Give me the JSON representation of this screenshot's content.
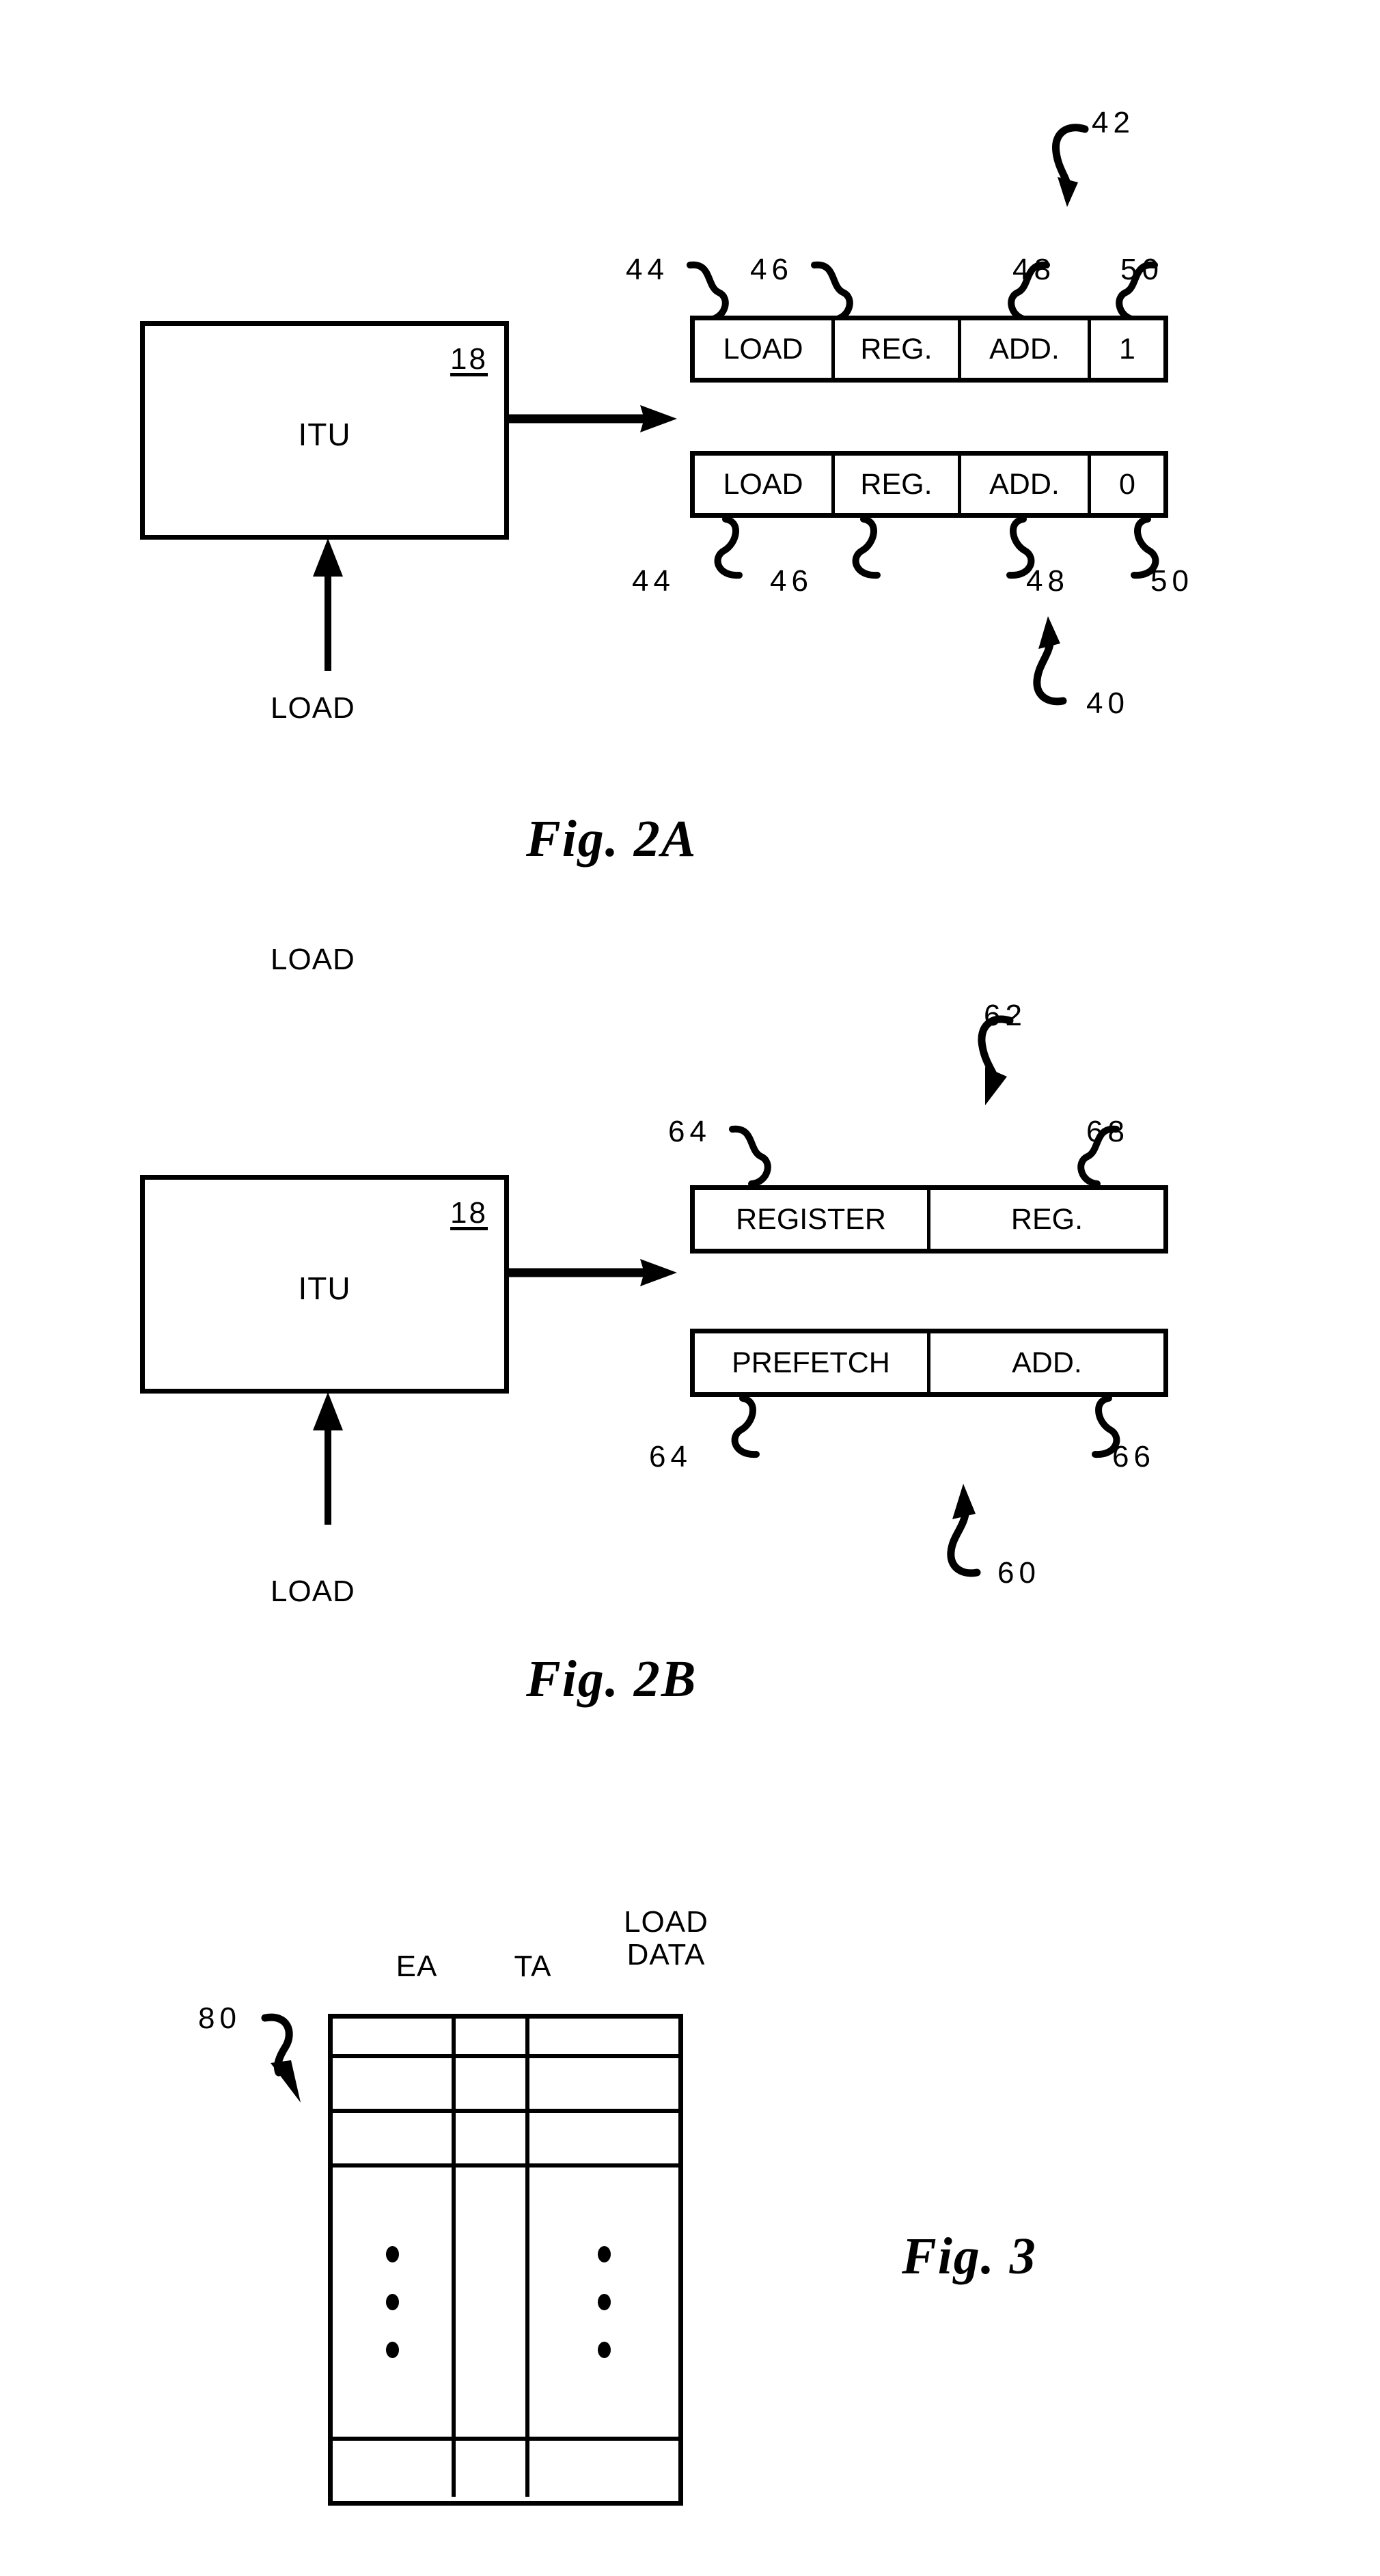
{
  "document": {
    "type": "patent-drawing-sheet",
    "figures": [
      {
        "id": "fig2a",
        "caption": "Fig.  2A",
        "unit": {
          "label": "ITU",
          "ref": "18"
        },
        "input_label": "LOAD",
        "group_ref_top": "42",
        "group_ref_bottom": "40",
        "field_refs_top": [
          "44",
          "46",
          "48",
          "50"
        ],
        "field_refs_bottom": [
          "44",
          "46",
          "48",
          "50"
        ],
        "instructions": [
          {
            "name": "instruction-word-42",
            "fields": [
              "LOAD",
              "REG.",
              "ADD.",
              "1"
            ]
          },
          {
            "name": "instruction-word-40",
            "fields": [
              "LOAD",
              "REG.",
              "ADD.",
              "0"
            ]
          }
        ]
      },
      {
        "id": "fig2b",
        "caption": "Fig.  2B",
        "unit": {
          "label": "ITU",
          "ref": "18"
        },
        "input_label": "LOAD",
        "group_ref_top": "62",
        "group_ref_bottom": "60",
        "field_refs_top": [
          "64",
          "68"
        ],
        "field_refs_bottom": [
          "64",
          "66"
        ],
        "instructions": [
          {
            "name": "instruction-word-62",
            "fields": [
              "REGISTER",
              "REG."
            ]
          },
          {
            "name": "instruction-word-60",
            "fields": [
              "PREFETCH",
              "ADD."
            ]
          }
        ]
      },
      {
        "id": "fig3",
        "caption": "Fig.  3",
        "table_ref": "80",
        "columns": [
          "EA",
          "TA",
          "LOAD\nDATA"
        ],
        "column_headers": [
          {
            "line1": "",
            "line2": "EA"
          },
          {
            "line1": "",
            "line2": "TA"
          },
          {
            "line1": "LOAD",
            "line2": "DATA"
          }
        ],
        "rows": [
          {
            "kind": "empty"
          },
          {
            "kind": "empty"
          },
          {
            "kind": "empty"
          },
          {
            "kind": "ellipsis",
            "ellipsis_columns": [
              0,
              2
            ],
            "dots_per_column": 3
          },
          {
            "kind": "empty"
          }
        ]
      }
    ],
    "colors": {
      "ink": "#000000",
      "paper": "#ffffff"
    }
  }
}
